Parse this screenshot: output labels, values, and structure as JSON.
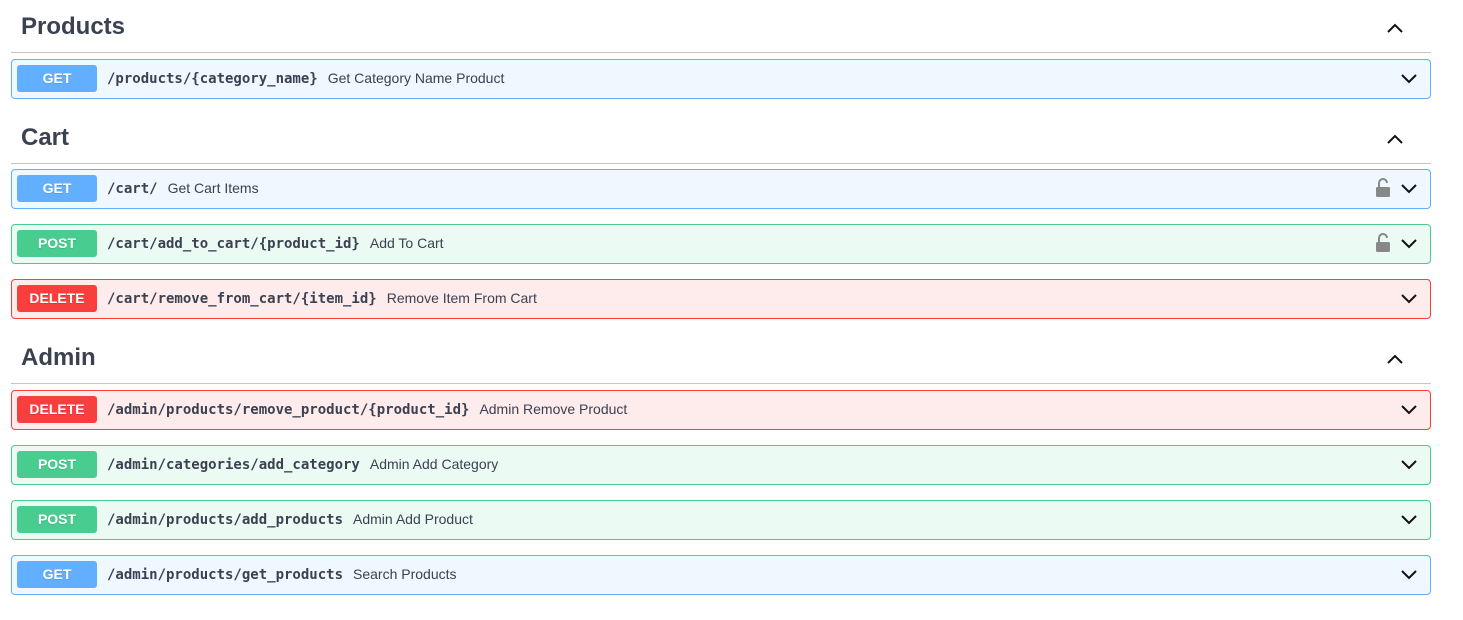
{
  "sections": [
    {
      "title": "Products",
      "operations": [
        {
          "method": "GET",
          "path": "/products/{category_name}",
          "summary": "Get Category Name Product",
          "locked": false
        }
      ]
    },
    {
      "title": "Cart",
      "operations": [
        {
          "method": "GET",
          "path": "/cart/",
          "summary": "Get Cart Items",
          "locked": true
        },
        {
          "method": "POST",
          "path": "/cart/add_to_cart/{product_id}",
          "summary": "Add To Cart",
          "locked": true
        },
        {
          "method": "DELETE",
          "path": "/cart/remove_from_cart/{item_id}",
          "summary": "Remove Item From Cart",
          "locked": false
        }
      ]
    },
    {
      "title": "Admin",
      "operations": [
        {
          "method": "DELETE",
          "path": "/admin/products/remove_product/{product_id}",
          "summary": "Admin Remove Product",
          "locked": false
        },
        {
          "method": "POST",
          "path": "/admin/categories/add_category",
          "summary": "Admin Add Category",
          "locked": false
        },
        {
          "method": "POST",
          "path": "/admin/products/add_products",
          "summary": "Admin Add Product",
          "locked": false
        },
        {
          "method": "GET",
          "path": "/admin/products/get_products",
          "summary": "Search Products",
          "locked": false
        }
      ]
    }
  ],
  "colors": {
    "get": "#61affe",
    "post": "#49cc90",
    "delete": "#f93e3e",
    "text": "#3b4151"
  },
  "icons": {
    "collapse": "chevron-up-icon",
    "expand": "chevron-down-icon",
    "lock": "unlocked-padlock-icon"
  }
}
